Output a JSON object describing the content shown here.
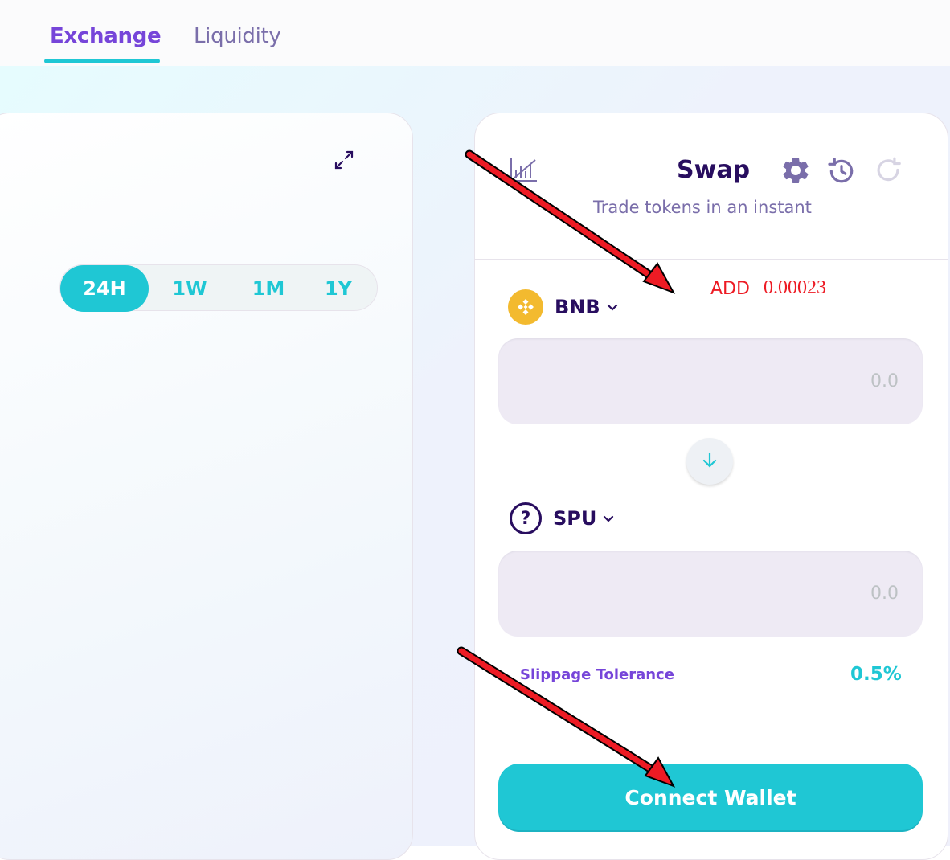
{
  "nav": {
    "tabs": [
      {
        "label": "Exchange",
        "active": true
      },
      {
        "label": "Liquidity",
        "active": false
      }
    ]
  },
  "chart": {
    "expand_icon": "expand-icon",
    "ranges": [
      "24H",
      "1W",
      "1M",
      "1Y"
    ],
    "active_range": "24H"
  },
  "swap": {
    "title": "Swap",
    "subtitle": "Trade tokens in an instant",
    "icons": {
      "chart_toggle": "chart-toggle-icon",
      "settings": "gear-icon",
      "history": "history-icon",
      "refresh": "refresh-icon"
    },
    "from": {
      "symbol": "BNB",
      "logo": "bnb-logo-icon",
      "placeholder": "0.0"
    },
    "to": {
      "symbol": "SPU",
      "logo": "question-mark-icon",
      "logo_glyph": "?",
      "placeholder": "0.0"
    },
    "switch_icon": "arrow-down-icon",
    "slippage": {
      "label": "Slippage Tolerance",
      "value": "0.5%"
    },
    "connect_label": "Connect Wallet"
  },
  "annotations": {
    "add_label": "ADD",
    "add_value": "0.00023",
    "arrow_color": "#ed1b24"
  },
  "colors": {
    "primary": "#1fc7d4",
    "secondary": "#7645d9",
    "text": "#280d5f",
    "text_subtle": "#7a6eaa",
    "input_bg": "#eeeaf4",
    "binance_yellow": "#f3ba2f"
  }
}
